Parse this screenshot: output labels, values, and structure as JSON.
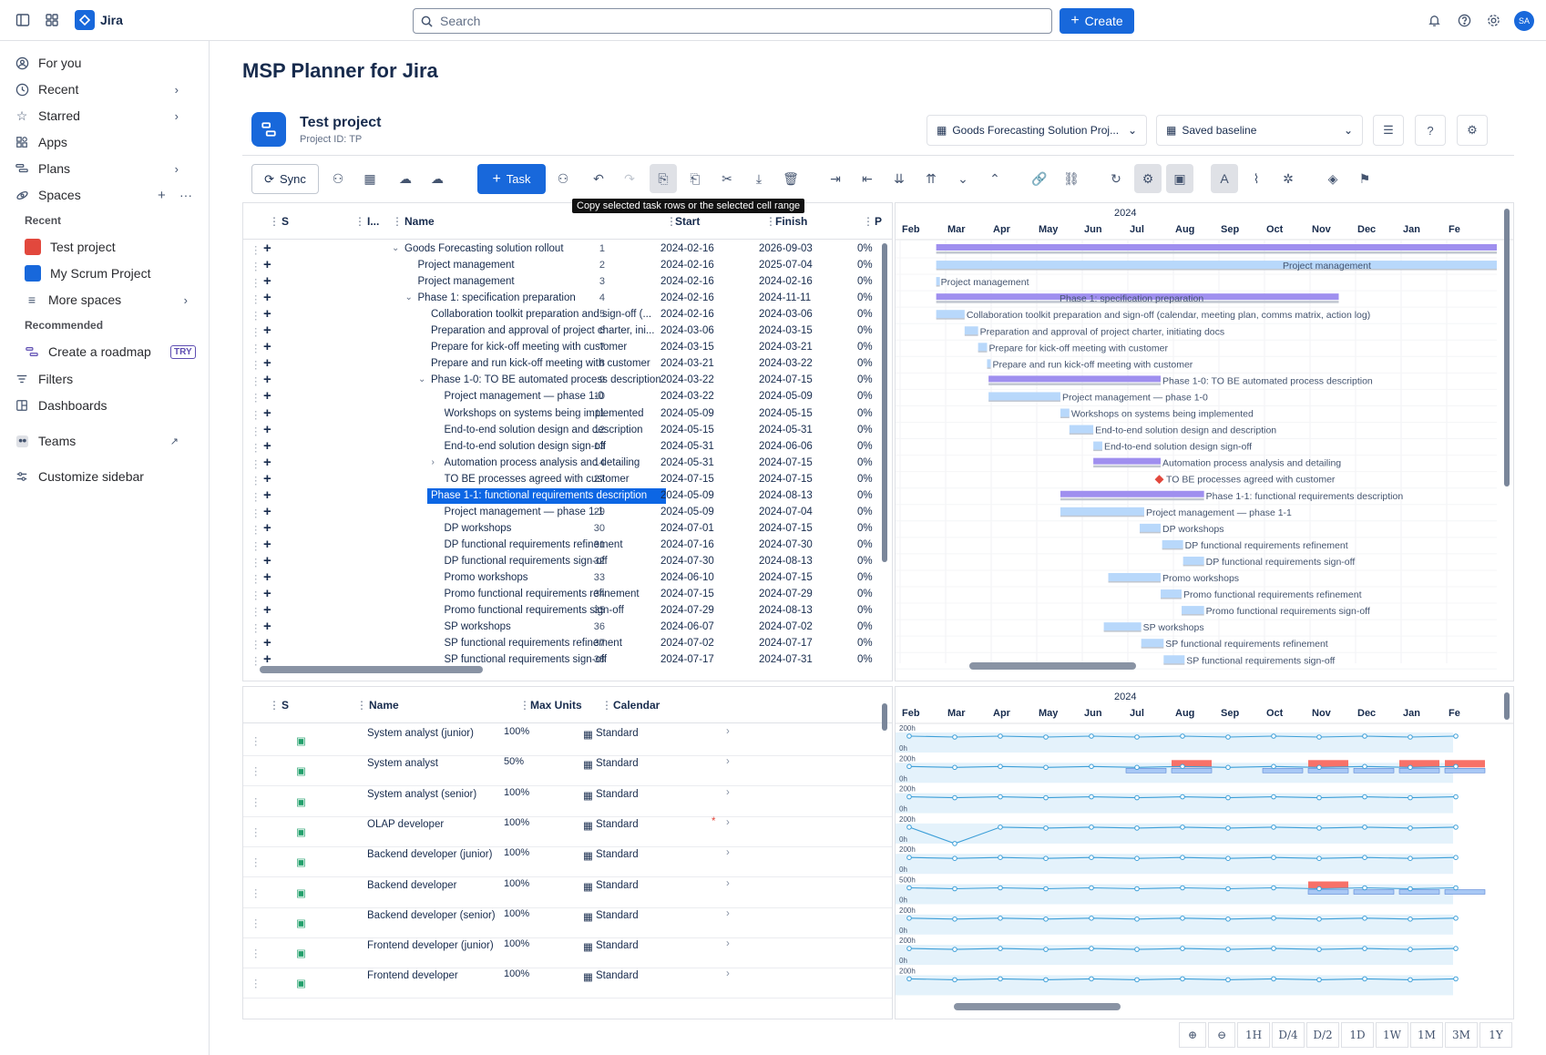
{
  "topbar": {
    "app_name": "Jira",
    "search_placeholder": "Search",
    "create_label": "Create",
    "avatar_initials": "SA"
  },
  "sidebar": {
    "items": [
      {
        "label": "For you",
        "icon": "person-icon"
      },
      {
        "label": "Recent",
        "icon": "clock-icon"
      },
      {
        "label": "Starred",
        "icon": "star-icon"
      },
      {
        "label": "Apps",
        "icon": "apps-icon"
      },
      {
        "label": "Plans",
        "icon": "plans-icon"
      },
      {
        "label": "Spaces",
        "icon": "spaces-icon"
      }
    ],
    "recent_heading": "Recent",
    "recent": [
      {
        "label": "Test project"
      },
      {
        "label": "My Scrum Project"
      },
      {
        "label": "More spaces"
      }
    ],
    "recommended_heading": "Recommended",
    "recommended": {
      "label": "Create a roadmap",
      "badge": "TRY"
    },
    "bottom": [
      {
        "label": "Filters"
      },
      {
        "label": "Dashboards"
      },
      {
        "label": "Teams"
      },
      {
        "label": "Customize sidebar"
      }
    ]
  },
  "page": {
    "title": "MSP Planner for Jira"
  },
  "project": {
    "name": "Test project",
    "id": "Project ID: TP",
    "plan_select": "Goods Forecasting Solution Proj...",
    "baseline_select": "Saved baseline"
  },
  "toolbar": {
    "sync_label": "Sync",
    "task_label": "Task",
    "tooltip": "Copy selected task rows or the selected cell range"
  },
  "grid": {
    "headers": {
      "s": "S",
      "id": "I...",
      "name": "Name",
      "start": "Start",
      "finish": "Finish",
      "p": "P"
    },
    "rows": [
      {
        "id": "1",
        "name": "Goods Forecasting solution rollout",
        "start": "2024-02-16",
        "finish": "2026-09-03",
        "pct": "0%",
        "indent": 0,
        "toggle": "v"
      },
      {
        "id": "2",
        "name": "Project management",
        "start": "2024-02-16",
        "finish": "2025-07-04",
        "pct": "0%",
        "indent": 1,
        "toggle": ""
      },
      {
        "id": "3",
        "name": "Project management",
        "start": "2024-02-16",
        "finish": "2024-02-16",
        "pct": "0%",
        "indent": 1,
        "toggle": ""
      },
      {
        "id": "4",
        "name": "Phase 1: specification preparation",
        "start": "2024-02-16",
        "finish": "2024-11-11",
        "pct": "0%",
        "indent": 1,
        "toggle": "v"
      },
      {
        "id": "5",
        "name": "Collaboration toolkit preparation and sign-off (...",
        "start": "2024-02-16",
        "finish": "2024-03-06",
        "pct": "0%",
        "indent": 2,
        "toggle": ""
      },
      {
        "id": "6",
        "name": "Preparation and approval of project charter, ini...",
        "start": "2024-03-06",
        "finish": "2024-03-15",
        "pct": "0%",
        "indent": 2,
        "toggle": ""
      },
      {
        "id": "7",
        "name": "Prepare for kick-off meeting with customer",
        "start": "2024-03-15",
        "finish": "2024-03-21",
        "pct": "0%",
        "indent": 2,
        "toggle": ""
      },
      {
        "id": "8",
        "name": "Prepare and run kick-off meeting with customer",
        "start": "2024-03-21",
        "finish": "2024-03-22",
        "pct": "0%",
        "indent": 2,
        "toggle": ""
      },
      {
        "id": "9",
        "name": "Phase 1-0: TO BE automated process description",
        "start": "2024-03-22",
        "finish": "2024-07-15",
        "pct": "0%",
        "indent": 2,
        "toggle": "v"
      },
      {
        "id": "10",
        "name": "Project management — phase 1-0",
        "start": "2024-03-22",
        "finish": "2024-05-09",
        "pct": "0%",
        "indent": 3,
        "toggle": ""
      },
      {
        "id": "11",
        "name": "Workshops on systems being implemented",
        "start": "2024-05-09",
        "finish": "2024-05-15",
        "pct": "0%",
        "indent": 3,
        "toggle": ""
      },
      {
        "id": "12",
        "name": "End-to-end solution design and description",
        "start": "2024-05-15",
        "finish": "2024-05-31",
        "pct": "0%",
        "indent": 3,
        "toggle": ""
      },
      {
        "id": "13",
        "name": "End-to-end solution design sign-off",
        "start": "2024-05-31",
        "finish": "2024-06-06",
        "pct": "0%",
        "indent": 3,
        "toggle": ""
      },
      {
        "id": "14",
        "name": "Automation process analysis and detailing",
        "start": "2024-05-31",
        "finish": "2024-07-15",
        "pct": "0%",
        "indent": 3,
        "toggle": ">"
      },
      {
        "id": "27",
        "name": "TO BE processes agreed with customer",
        "start": "2024-07-15",
        "finish": "2024-07-15",
        "pct": "0%",
        "indent": 3,
        "toggle": ""
      },
      {
        "id": "28",
        "name": "Phase 1-1: functional requirements description",
        "start": "2024-05-09",
        "finish": "2024-08-13",
        "pct": "0%",
        "indent": 2,
        "toggle": "",
        "selected": true
      },
      {
        "id": "29",
        "name": "Project management — phase 1-1",
        "start": "2024-05-09",
        "finish": "2024-07-04",
        "pct": "0%",
        "indent": 3,
        "toggle": ""
      },
      {
        "id": "30",
        "name": "DP workshops",
        "start": "2024-07-01",
        "finish": "2024-07-15",
        "pct": "0%",
        "indent": 3,
        "toggle": ""
      },
      {
        "id": "31",
        "name": "DP functional requirements refinement",
        "start": "2024-07-16",
        "finish": "2024-07-30",
        "pct": "0%",
        "indent": 3,
        "toggle": ""
      },
      {
        "id": "32",
        "name": "DP functional requirements sign-off",
        "start": "2024-07-30",
        "finish": "2024-08-13",
        "pct": "0%",
        "indent": 3,
        "toggle": ""
      },
      {
        "id": "33",
        "name": "Promo workshops",
        "start": "2024-06-10",
        "finish": "2024-07-15",
        "pct": "0%",
        "indent": 3,
        "toggle": ""
      },
      {
        "id": "34",
        "name": "Promo functional requirements refinement",
        "start": "2024-07-15",
        "finish": "2024-07-29",
        "pct": "0%",
        "indent": 3,
        "toggle": ""
      },
      {
        "id": "35",
        "name": "Promo functional requirements sign-off",
        "start": "2024-07-29",
        "finish": "2024-08-13",
        "pct": "0%",
        "indent": 3,
        "toggle": ""
      },
      {
        "id": "36",
        "name": "SP workshops",
        "start": "2024-06-07",
        "finish": "2024-07-02",
        "pct": "0%",
        "indent": 3,
        "toggle": ""
      },
      {
        "id": "37",
        "name": "SP functional requirements refinement",
        "start": "2024-07-02",
        "finish": "2024-07-17",
        "pct": "0%",
        "indent": 3,
        "toggle": ""
      },
      {
        "id": "38",
        "name": "SP functional requirements sign-off",
        "start": "2024-07-17",
        "finish": "2024-07-31",
        "pct": "0%",
        "indent": 3,
        "toggle": ""
      }
    ]
  },
  "gantt": {
    "year": "2024",
    "months": [
      "Feb",
      "Mar",
      "Apr",
      "May",
      "Jun",
      "Jul",
      "Aug",
      "Sep",
      "Oct",
      "Nov",
      "Dec",
      "Jan",
      "Fe"
    ],
    "bars": [
      {
        "label": "",
        "type": "summary"
      },
      {
        "label": "Project management",
        "type": "task",
        "label_inside": true
      },
      {
        "label": "Project management",
        "type": "task"
      },
      {
        "label": "Phase 1: specification preparation",
        "type": "summary",
        "label_inside": true
      },
      {
        "label": "Collaboration toolkit preparation and sign-off (calendar, meeting plan, comms matrix, action log)",
        "type": "task"
      },
      {
        "label": "Preparation and approval of project charter, initiating docs",
        "type": "task"
      },
      {
        "label": "Prepare for kick-off meeting with customer",
        "type": "task"
      },
      {
        "label": "Prepare and run kick-off meeting with customer",
        "type": "task"
      },
      {
        "label": "Phase 1-0: TO BE automated process description",
        "type": "summary"
      },
      {
        "label": "Project management — phase 1-0",
        "type": "task"
      },
      {
        "label": "Workshops on systems being implemented",
        "type": "task"
      },
      {
        "label": "End-to-end solution design and description",
        "type": "task"
      },
      {
        "label": "End-to-end solution design sign-off",
        "type": "task"
      },
      {
        "label": "Automation process analysis and detailing",
        "type": "summary"
      },
      {
        "label": "TO BE processes agreed with customer",
        "type": "milestone"
      },
      {
        "label": "Phase 1-1: functional requirements description",
        "type": "summary"
      },
      {
        "label": "Project management — phase 1-1",
        "type": "task"
      },
      {
        "label": "DP workshops",
        "type": "task"
      },
      {
        "label": "DP functional requirements refinement",
        "type": "task"
      },
      {
        "label": "DP functional requirements sign-off",
        "type": "task"
      },
      {
        "label": "Promo workshops",
        "type": "task"
      },
      {
        "label": "Promo functional requirements refinement",
        "type": "task"
      },
      {
        "label": "Promo functional requirements sign-off",
        "type": "task"
      },
      {
        "label": "SP workshops",
        "type": "task"
      },
      {
        "label": "SP functional requirements refinement",
        "type": "task"
      },
      {
        "label": "SP functional requirements sign-off",
        "type": "task"
      }
    ]
  },
  "resources": {
    "headers": {
      "s": "S",
      "name": "Name",
      "max_units": "Max Units",
      "calendar": "Calendar"
    },
    "rows": [
      {
        "name": "System analyst (junior)",
        "units": "100%",
        "calendar": "Standard"
      },
      {
        "name": "System analyst",
        "units": "50%",
        "calendar": "Standard"
      },
      {
        "name": "System analyst (senior)",
        "units": "100%",
        "calendar": "Standard"
      },
      {
        "name": "OLAP developer",
        "units": "100%",
        "calendar": "Standard",
        "flag": "*"
      },
      {
        "name": "Backend developer (junior)",
        "units": "100%",
        "calendar": "Standard"
      },
      {
        "name": "Backend developer",
        "units": "100%",
        "calendar": "Standard"
      },
      {
        "name": "Backend developer (senior)",
        "units": "100%",
        "calendar": "Standard"
      },
      {
        "name": "Frontend developer (junior)",
        "units": "100%",
        "calendar": "Standard"
      },
      {
        "name": "Frontend developer",
        "units": "100%",
        "calendar": "Standard"
      }
    ]
  },
  "usage": {
    "year": "2024",
    "months": [
      "Feb",
      "Mar",
      "Apr",
      "May",
      "Jun",
      "Jul",
      "Aug",
      "Sep",
      "Oct",
      "Nov",
      "Dec",
      "Jan",
      "Fe"
    ],
    "lanes": [
      {
        "top": "200h",
        "bottom": "0h"
      },
      {
        "top": "200h",
        "bottom": "0h"
      },
      {
        "top": "200h",
        "bottom": "0h"
      },
      {
        "top": "200h",
        "bottom": "0h"
      },
      {
        "top": "200h",
        "bottom": "0h"
      },
      {
        "top": "500h",
        "bottom": "0h"
      },
      {
        "top": "200h",
        "bottom": "0h"
      },
      {
        "top": "200h",
        "bottom": "0h"
      },
      {
        "top": "200h",
        "bottom": ""
      }
    ]
  },
  "zoom": [
    "1H",
    "D/4",
    "D/2",
    "1D",
    "1W",
    "1M",
    "3M",
    "1Y"
  ],
  "colors": {
    "accent": "#1868db",
    "summary": "#9f8fef",
    "task": "#b8d8fb",
    "baseline": "#c1c7d0",
    "milestone": "#e2483d",
    "overalloc": "#f87168"
  }
}
